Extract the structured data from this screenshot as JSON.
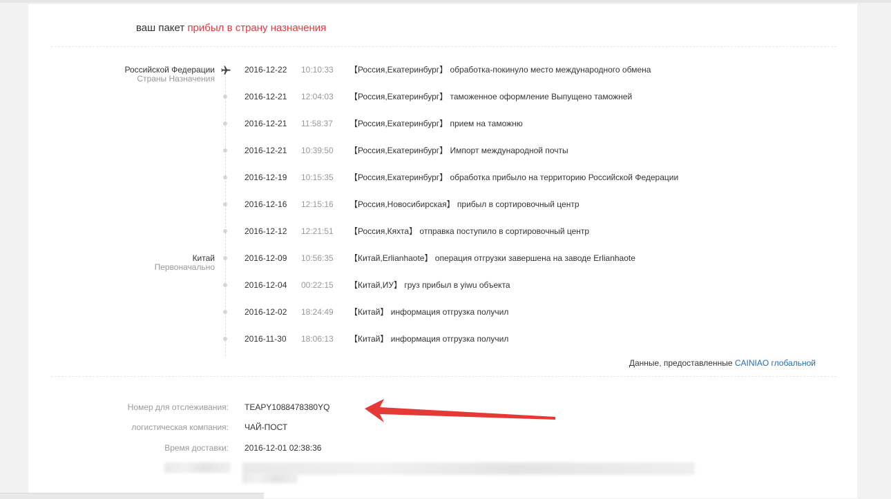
{
  "status": {
    "prefix": "ваш пакет",
    "highlight": "прибыл в страну назначения"
  },
  "regions": [
    {
      "name": "Российской Федерации",
      "sub": "Страны Назначения"
    },
    {
      "name": "Китай",
      "sub": "Первоначально"
    }
  ],
  "events": [
    {
      "date": "2016-12-22",
      "time": "10:10:33",
      "message": "【Россия,Екатеринбург】 обработка-покинуло место международного обмена"
    },
    {
      "date": "2016-12-21",
      "time": "12:04:03",
      "message": "【Россия,Екатеринбург】 таможенное оформление Выпущено таможней"
    },
    {
      "date": "2016-12-21",
      "time": "11:58:37",
      "message": "【Россия,Екатеринбург】 прием на таможню"
    },
    {
      "date": "2016-12-21",
      "time": "10:39:50",
      "message": "【Россия,Екатеринбург】 Импорт международной почты"
    },
    {
      "date": "2016-12-19",
      "time": "10:15:35",
      "message": "【Россия,Екатеринбург】 обработка прибыло на территорию Российской Федерации"
    },
    {
      "date": "2016-12-16",
      "time": "12:15:16",
      "message": "【Россия,Новосибирская】 прибыл в сортировочный центр"
    },
    {
      "date": "2016-12-12",
      "time": "12:21:51",
      "message": "【Россия,Кяхта】 отправка поступило в сортировочный центр"
    },
    {
      "date": "2016-12-09",
      "time": "10:56:35",
      "message": "【Китай,Erlianhaote】 операция отгрузки завершена на заводе Erlianhaote"
    },
    {
      "date": "2016-12-04",
      "time": "00:22:15",
      "message": "【Китай,ИУ】 груз прибыл в yiwu объекта"
    },
    {
      "date": "2016-12-02",
      "time": "18:24:49",
      "message": "【Китай】 информация отгрузка получил"
    },
    {
      "date": "2016-11-30",
      "time": "18:06:13",
      "message": "【Китай】 информация отгрузка получил"
    }
  ],
  "provider": {
    "prefix": "Данные, предоставленные",
    "link": "CAINIAO глобальной"
  },
  "info": {
    "tracking_label": "Номер для отслеживания:",
    "tracking_value": "TEAPY1088478380YQ",
    "company_label": "логистическая компания:",
    "company_value": "ЧАЙ-ПОСТ",
    "delivery_label": "Время доставки:",
    "delivery_value": "2016-12-01 02:38:36"
  },
  "colors": {
    "highlight": "#e4393c",
    "link": "#1e6bb8",
    "arrow": "#e53935"
  },
  "icons": {
    "origin_marker": "plane-icon"
  }
}
